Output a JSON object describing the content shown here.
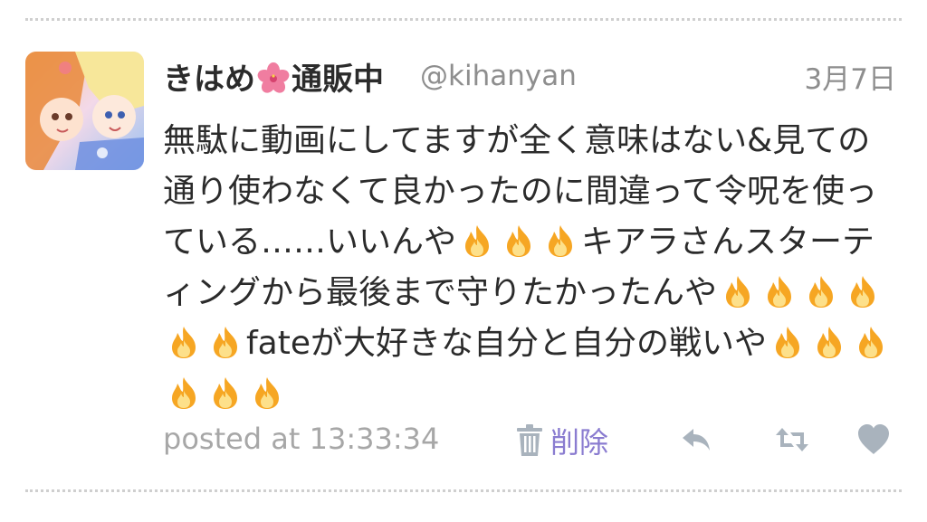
{
  "tweet": {
    "display_name": "きはめ",
    "display_name_suffix": "通販中",
    "name_emoji": "hibiscus-icon",
    "handle": "@kihanyan",
    "date": "3月7日",
    "text": {
      "part1": "無駄に動画にしてますが全く意味はない&見ての通り使わなくて良かったのに間違って令呪を使っている……いいんや",
      "part2": "キアラさんスターティングから最後まで守りたかったんや",
      "part3": "fateが大好きな自分と自分の戦いや",
      "emoji": "fire-icon"
    },
    "posted_at": "posted at 13:33:34",
    "delete_label": "削除"
  },
  "colors": {
    "name_text": "#2b2b2b",
    "meta_gray": "#8e8e8e",
    "delete_link": "#8a7cd0",
    "action_icon": "#a9b3bd",
    "divider": "#cfcfcf"
  },
  "actions": [
    "reply-icon",
    "retweet-icon",
    "heart-icon"
  ]
}
